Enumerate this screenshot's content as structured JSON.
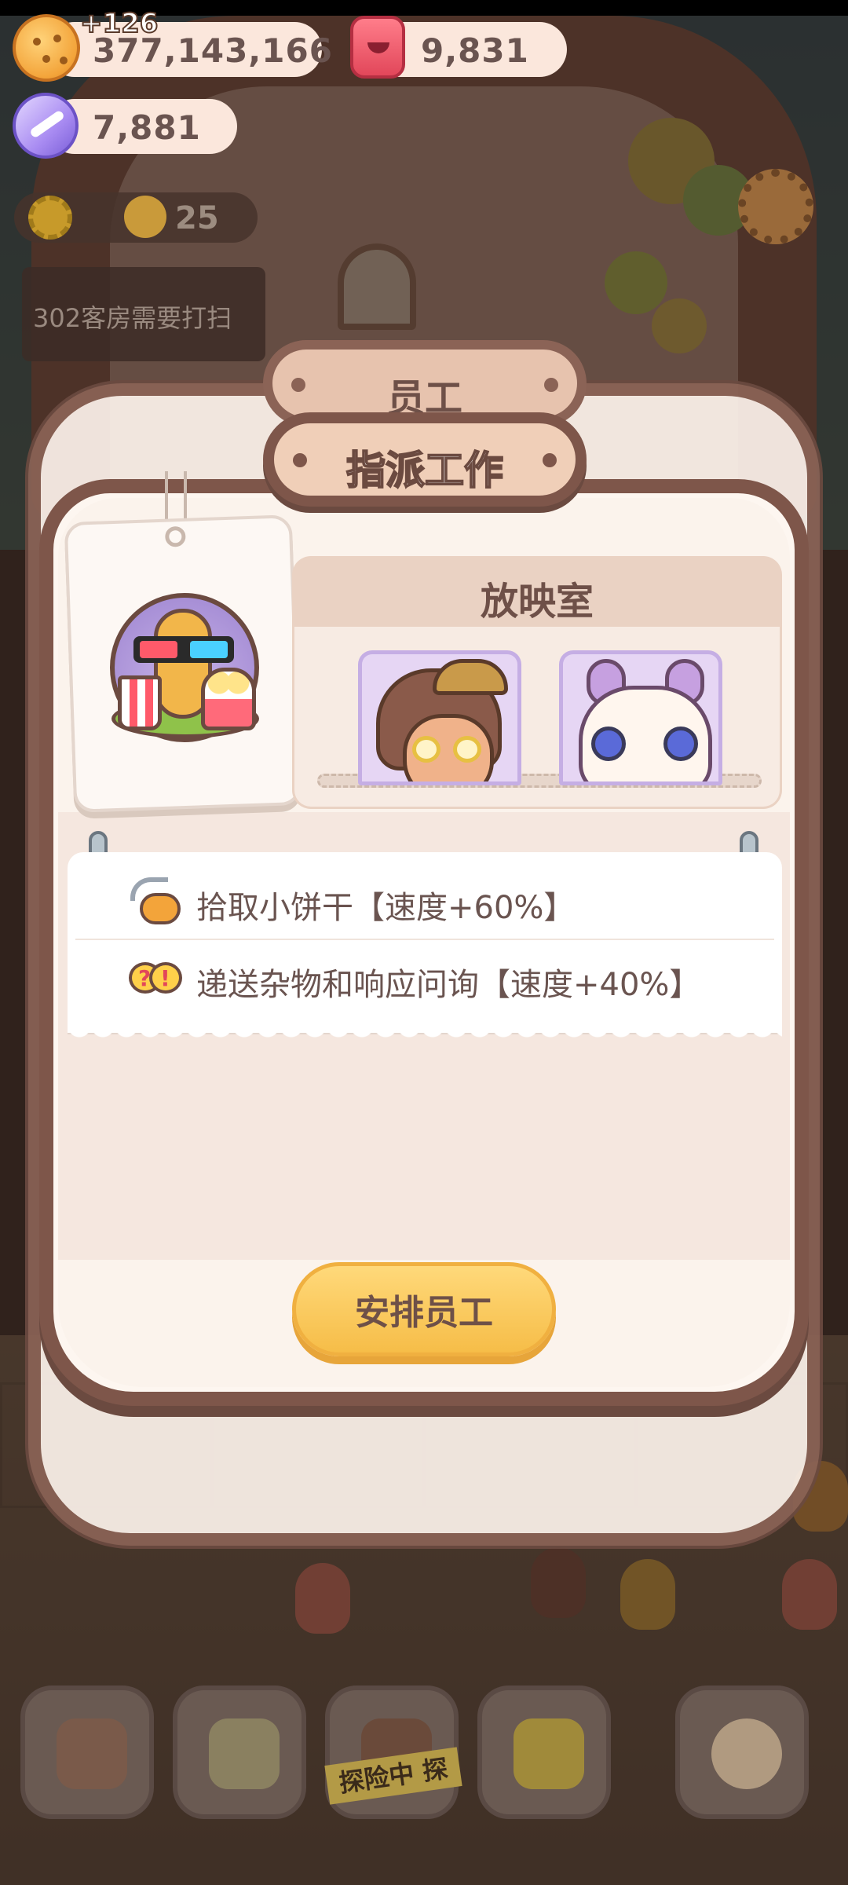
{
  "hud": {
    "bonus_popup": "+126",
    "coins": "377,143,166",
    "rubies": "9,831",
    "crystals": "7,881",
    "energy": "25",
    "task_notice": "302客房需要打扫"
  },
  "staff_panel": {
    "title": "员工"
  },
  "assign_dialog": {
    "title": "指派工作",
    "room_name": "放映室",
    "staff_portraits": [
      "artist-gentleman-portrait",
      "white-dragon-portrait"
    ],
    "skills": [
      {
        "icon": "vacuum-icon",
        "text": "拾取小饼干【速度+60%】"
      },
      {
        "icon": "speech-bubbles-icon",
        "text": "递送杂物和响应问询【速度+40%】"
      }
    ],
    "action_label": "安排员工"
  },
  "bottom_nav": {
    "items": [
      "house-icon",
      "notebook-icon",
      "explore-icon",
      "shop-bag-icon",
      "cookie-pet-icon"
    ],
    "explore_stamp": "探险中 探"
  },
  "colors": {
    "frame_brown": "#7e564a",
    "panel_cream": "#fbf3ec",
    "button_yellow": "#f6bd48",
    "text_brown": "#6e5048"
  }
}
